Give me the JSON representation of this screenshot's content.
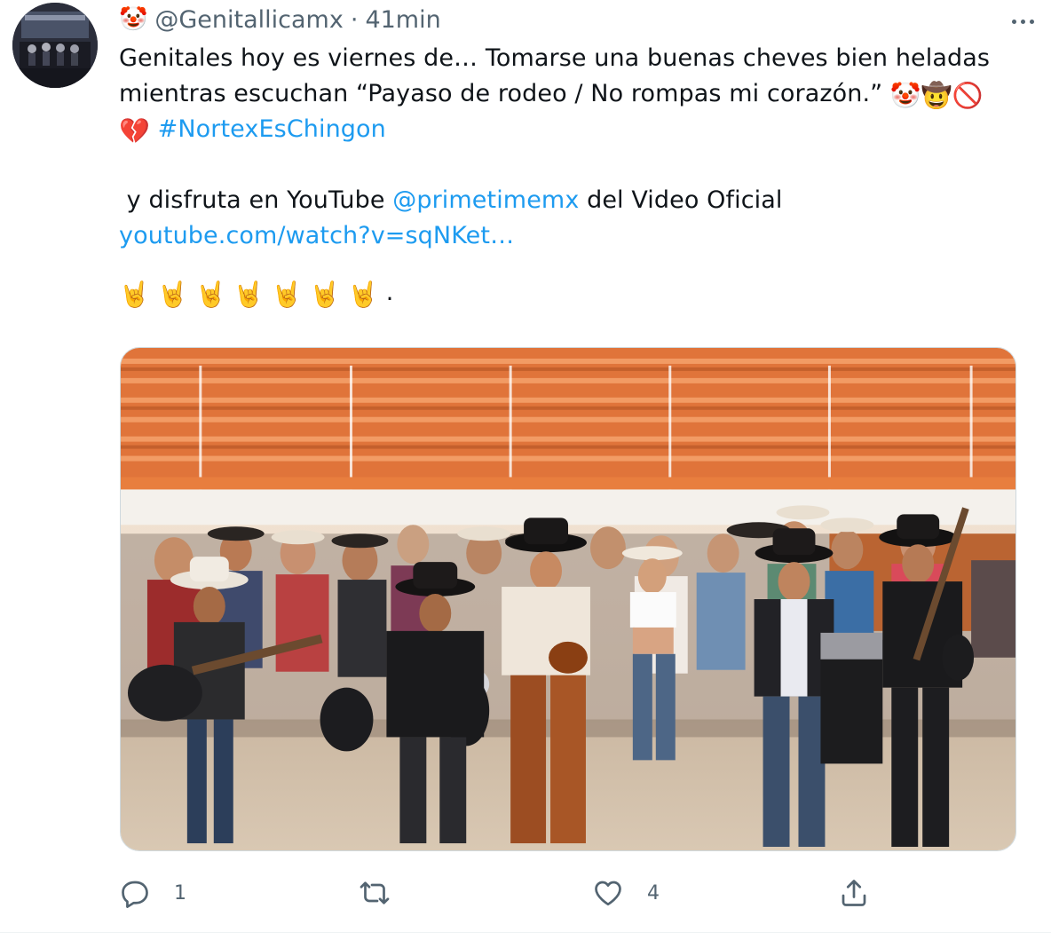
{
  "author": {
    "avatar_alt": "avatar",
    "handle_emoji": "🤡",
    "handle": "@Genitallicamx",
    "separator": "·",
    "time": "41min"
  },
  "tweet": {
    "line1": "Genitales hoy es viernes de… Tomarse una buenas cheves bien heladas",
    "line2_text": "mientras escuchan “Payaso de rodeo / No rompas mi corazón.”",
    "line2_emojis": "🤡🤠🚫",
    "line3_emoji": "💔",
    "hashtag": "#NortexEsChingon",
    "line4_pre": " y disfruta en YouTube ",
    "mention": "@primetimemx",
    "line4_post": " del Video Oficial",
    "url": "youtube.com/watch?v=sqNKet…",
    "rock_emojis": [
      "🤘",
      "🤘",
      "🤘",
      "🤘",
      "🤘",
      "🤘",
      "🤘"
    ],
    "rock_suffix": "."
  },
  "actions": {
    "reply_count": "1",
    "retweet_count": "",
    "like_count": "4"
  },
  "colors": {
    "link": "#1d9bf0",
    "secondary": "#536471",
    "text": "#0f1419"
  },
  "icons": [
    "more-icon",
    "reply-icon",
    "retweet-icon",
    "like-icon",
    "share-icon"
  ]
}
